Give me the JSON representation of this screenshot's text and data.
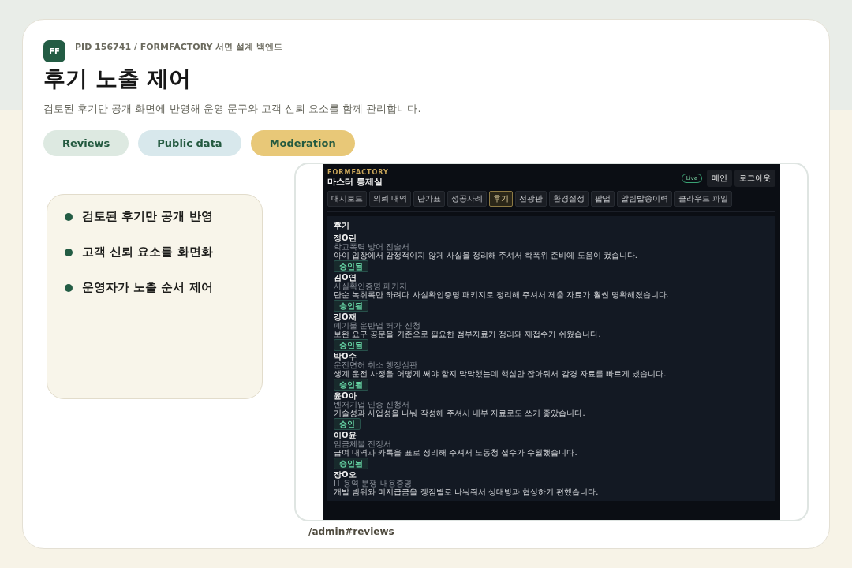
{
  "header": {
    "logo": "FF",
    "breadcrumb": "PID 156741 / FORMFACTORY 서면 설계 백엔드",
    "title": "후기 노출 제어",
    "subtitle": "검토된 후기만 공개 화면에 반영해 운영 문구와 고객 신뢰 요소를 함께 관리합니다."
  },
  "chips": [
    {
      "label": "Reviews",
      "color": "#dde9e1"
    },
    {
      "label": "Public data",
      "color": "#d8e8ec"
    },
    {
      "label": "Moderation",
      "color": "#e8c878"
    }
  ],
  "points": [
    "검토된 후기만 공개 반영",
    "고객 신뢰 요소를 화면화",
    "운영자가 노출 순서 제어"
  ],
  "preview": {
    "brand": "FORMFACTORY",
    "title": "마스터 통제실",
    "badge": "Live",
    "actions": [
      "메인",
      "로그아웃"
    ],
    "tabs": [
      {
        "label": "대시보드",
        "selected": false
      },
      {
        "label": "의뢰 내역",
        "selected": false
      },
      {
        "label": "단가표",
        "selected": false
      },
      {
        "label": "성공사례",
        "selected": false
      },
      {
        "label": "후기",
        "selected": true
      },
      {
        "label": "전광판",
        "selected": false
      },
      {
        "label": "환경설정",
        "selected": false
      },
      {
        "label": "팝업",
        "selected": false
      },
      {
        "label": "알림발송이력",
        "selected": false
      },
      {
        "label": "클라우드 파일",
        "selected": false
      }
    ],
    "section_title": "후기",
    "reviews": [
      {
        "name": "정O린",
        "service": "학교폭력 방어 진술서",
        "text": "아이 입장에서 감정적이지 않게 사실을 정리해 주셔서 학폭위 준비에 도움이 컸습니다.",
        "button": "승인됨"
      },
      {
        "name": "김O연",
        "service": "사실확인증명 패키지",
        "text": "단순 녹취록만 하려다 사실확인증명 패키지로 정리해 주셔서 제출 자료가 훨씬 명확해졌습니다.",
        "button": "승인됨"
      },
      {
        "name": "강O재",
        "service": "폐기물 운반업 허가 신청",
        "text": "보완 요구 공문을 기준으로 필요한 첨부자료가 정리돼 재접수가 쉬웠습니다.",
        "button": "승인됨"
      },
      {
        "name": "박O수",
        "service": "운전면허 취소 행정심판",
        "text": "생계 운전 사정을 어떻게 써야 할지 막막했는데 핵심만 잡아줘서 감경 자료를 빠르게 냈습니다.",
        "button": "승인됨"
      },
      {
        "name": "윤O아",
        "service": "벤처기업 인증 신청서",
        "text": "기술성과 사업성을 나눠 작성해 주셔서 내부 자료로도 쓰기 좋았습니다.",
        "button": "승인"
      },
      {
        "name": "이O윤",
        "service": "임금체불 진정서",
        "text": "급여 내역과 카톡을 표로 정리해 주셔서 노동청 접수가 수월했습니다.",
        "button": "승인됨"
      },
      {
        "name": "장O오",
        "service": "IT 용역 분쟁 내용증명",
        "text": "개발 범위와 미지급금을 쟁점별로 나눠줘서 상대방과 협상하기 편했습니다."
      }
    ]
  },
  "caption": "/admin#reviews"
}
